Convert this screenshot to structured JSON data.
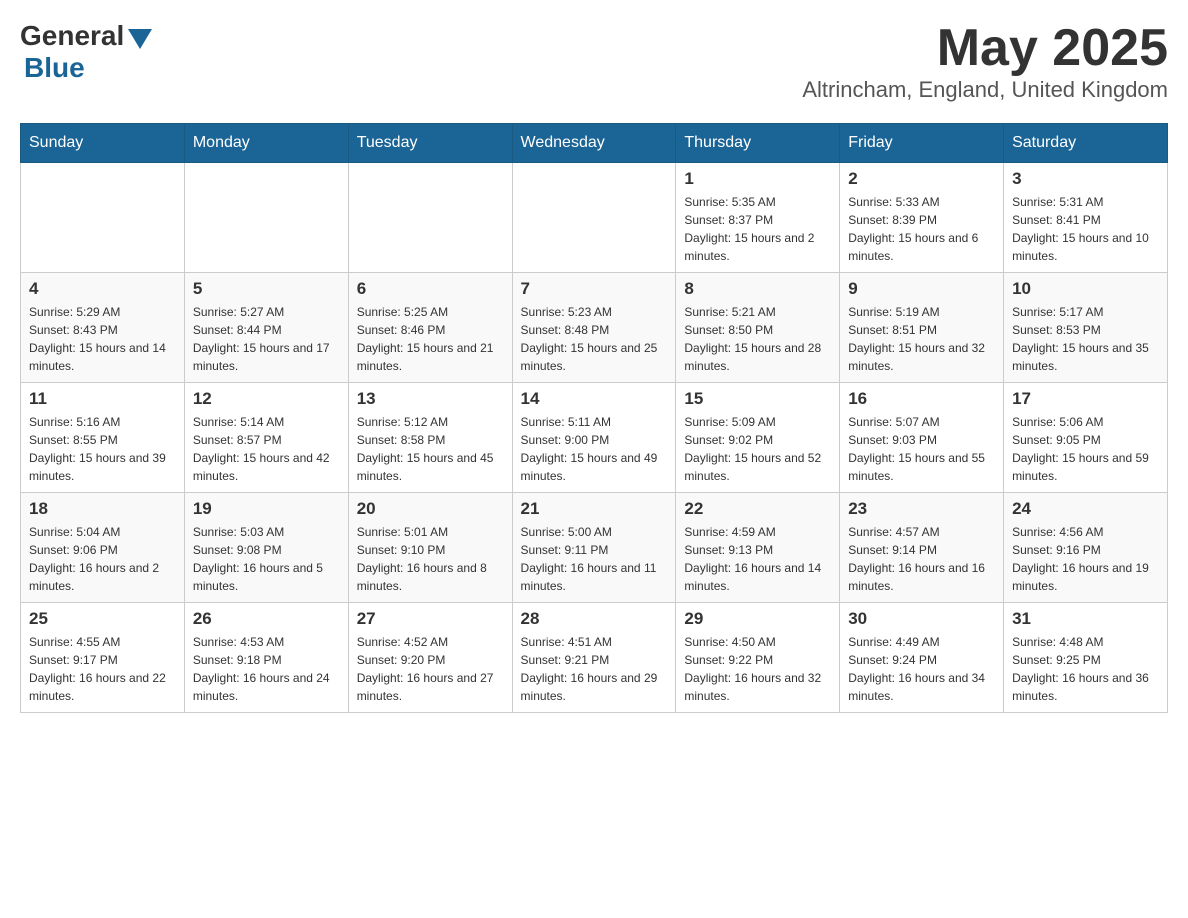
{
  "header": {
    "logo_general": "General",
    "logo_blue": "Blue",
    "month_title": "May 2025",
    "location": "Altrincham, England, United Kingdom"
  },
  "days_of_week": [
    "Sunday",
    "Monday",
    "Tuesday",
    "Wednesday",
    "Thursday",
    "Friday",
    "Saturday"
  ],
  "weeks": [
    [
      {
        "day": "",
        "sunrise": "",
        "sunset": "",
        "daylight": ""
      },
      {
        "day": "",
        "sunrise": "",
        "sunset": "",
        "daylight": ""
      },
      {
        "day": "",
        "sunrise": "",
        "sunset": "",
        "daylight": ""
      },
      {
        "day": "",
        "sunrise": "",
        "sunset": "",
        "daylight": ""
      },
      {
        "day": "1",
        "sunrise": "Sunrise: 5:35 AM",
        "sunset": "Sunset: 8:37 PM",
        "daylight": "Daylight: 15 hours and 2 minutes."
      },
      {
        "day": "2",
        "sunrise": "Sunrise: 5:33 AM",
        "sunset": "Sunset: 8:39 PM",
        "daylight": "Daylight: 15 hours and 6 minutes."
      },
      {
        "day": "3",
        "sunrise": "Sunrise: 5:31 AM",
        "sunset": "Sunset: 8:41 PM",
        "daylight": "Daylight: 15 hours and 10 minutes."
      }
    ],
    [
      {
        "day": "4",
        "sunrise": "Sunrise: 5:29 AM",
        "sunset": "Sunset: 8:43 PM",
        "daylight": "Daylight: 15 hours and 14 minutes."
      },
      {
        "day": "5",
        "sunrise": "Sunrise: 5:27 AM",
        "sunset": "Sunset: 8:44 PM",
        "daylight": "Daylight: 15 hours and 17 minutes."
      },
      {
        "day": "6",
        "sunrise": "Sunrise: 5:25 AM",
        "sunset": "Sunset: 8:46 PM",
        "daylight": "Daylight: 15 hours and 21 minutes."
      },
      {
        "day": "7",
        "sunrise": "Sunrise: 5:23 AM",
        "sunset": "Sunset: 8:48 PM",
        "daylight": "Daylight: 15 hours and 25 minutes."
      },
      {
        "day": "8",
        "sunrise": "Sunrise: 5:21 AM",
        "sunset": "Sunset: 8:50 PM",
        "daylight": "Daylight: 15 hours and 28 minutes."
      },
      {
        "day": "9",
        "sunrise": "Sunrise: 5:19 AM",
        "sunset": "Sunset: 8:51 PM",
        "daylight": "Daylight: 15 hours and 32 minutes."
      },
      {
        "day": "10",
        "sunrise": "Sunrise: 5:17 AM",
        "sunset": "Sunset: 8:53 PM",
        "daylight": "Daylight: 15 hours and 35 minutes."
      }
    ],
    [
      {
        "day": "11",
        "sunrise": "Sunrise: 5:16 AM",
        "sunset": "Sunset: 8:55 PM",
        "daylight": "Daylight: 15 hours and 39 minutes."
      },
      {
        "day": "12",
        "sunrise": "Sunrise: 5:14 AM",
        "sunset": "Sunset: 8:57 PM",
        "daylight": "Daylight: 15 hours and 42 minutes."
      },
      {
        "day": "13",
        "sunrise": "Sunrise: 5:12 AM",
        "sunset": "Sunset: 8:58 PM",
        "daylight": "Daylight: 15 hours and 45 minutes."
      },
      {
        "day": "14",
        "sunrise": "Sunrise: 5:11 AM",
        "sunset": "Sunset: 9:00 PM",
        "daylight": "Daylight: 15 hours and 49 minutes."
      },
      {
        "day": "15",
        "sunrise": "Sunrise: 5:09 AM",
        "sunset": "Sunset: 9:02 PM",
        "daylight": "Daylight: 15 hours and 52 minutes."
      },
      {
        "day": "16",
        "sunrise": "Sunrise: 5:07 AM",
        "sunset": "Sunset: 9:03 PM",
        "daylight": "Daylight: 15 hours and 55 minutes."
      },
      {
        "day": "17",
        "sunrise": "Sunrise: 5:06 AM",
        "sunset": "Sunset: 9:05 PM",
        "daylight": "Daylight: 15 hours and 59 minutes."
      }
    ],
    [
      {
        "day": "18",
        "sunrise": "Sunrise: 5:04 AM",
        "sunset": "Sunset: 9:06 PM",
        "daylight": "Daylight: 16 hours and 2 minutes."
      },
      {
        "day": "19",
        "sunrise": "Sunrise: 5:03 AM",
        "sunset": "Sunset: 9:08 PM",
        "daylight": "Daylight: 16 hours and 5 minutes."
      },
      {
        "day": "20",
        "sunrise": "Sunrise: 5:01 AM",
        "sunset": "Sunset: 9:10 PM",
        "daylight": "Daylight: 16 hours and 8 minutes."
      },
      {
        "day": "21",
        "sunrise": "Sunrise: 5:00 AM",
        "sunset": "Sunset: 9:11 PM",
        "daylight": "Daylight: 16 hours and 11 minutes."
      },
      {
        "day": "22",
        "sunrise": "Sunrise: 4:59 AM",
        "sunset": "Sunset: 9:13 PM",
        "daylight": "Daylight: 16 hours and 14 minutes."
      },
      {
        "day": "23",
        "sunrise": "Sunrise: 4:57 AM",
        "sunset": "Sunset: 9:14 PM",
        "daylight": "Daylight: 16 hours and 16 minutes."
      },
      {
        "day": "24",
        "sunrise": "Sunrise: 4:56 AM",
        "sunset": "Sunset: 9:16 PM",
        "daylight": "Daylight: 16 hours and 19 minutes."
      }
    ],
    [
      {
        "day": "25",
        "sunrise": "Sunrise: 4:55 AM",
        "sunset": "Sunset: 9:17 PM",
        "daylight": "Daylight: 16 hours and 22 minutes."
      },
      {
        "day": "26",
        "sunrise": "Sunrise: 4:53 AM",
        "sunset": "Sunset: 9:18 PM",
        "daylight": "Daylight: 16 hours and 24 minutes."
      },
      {
        "day": "27",
        "sunrise": "Sunrise: 4:52 AM",
        "sunset": "Sunset: 9:20 PM",
        "daylight": "Daylight: 16 hours and 27 minutes."
      },
      {
        "day": "28",
        "sunrise": "Sunrise: 4:51 AM",
        "sunset": "Sunset: 9:21 PM",
        "daylight": "Daylight: 16 hours and 29 minutes."
      },
      {
        "day": "29",
        "sunrise": "Sunrise: 4:50 AM",
        "sunset": "Sunset: 9:22 PM",
        "daylight": "Daylight: 16 hours and 32 minutes."
      },
      {
        "day": "30",
        "sunrise": "Sunrise: 4:49 AM",
        "sunset": "Sunset: 9:24 PM",
        "daylight": "Daylight: 16 hours and 34 minutes."
      },
      {
        "day": "31",
        "sunrise": "Sunrise: 4:48 AM",
        "sunset": "Sunset: 9:25 PM",
        "daylight": "Daylight: 16 hours and 36 minutes."
      }
    ]
  ]
}
